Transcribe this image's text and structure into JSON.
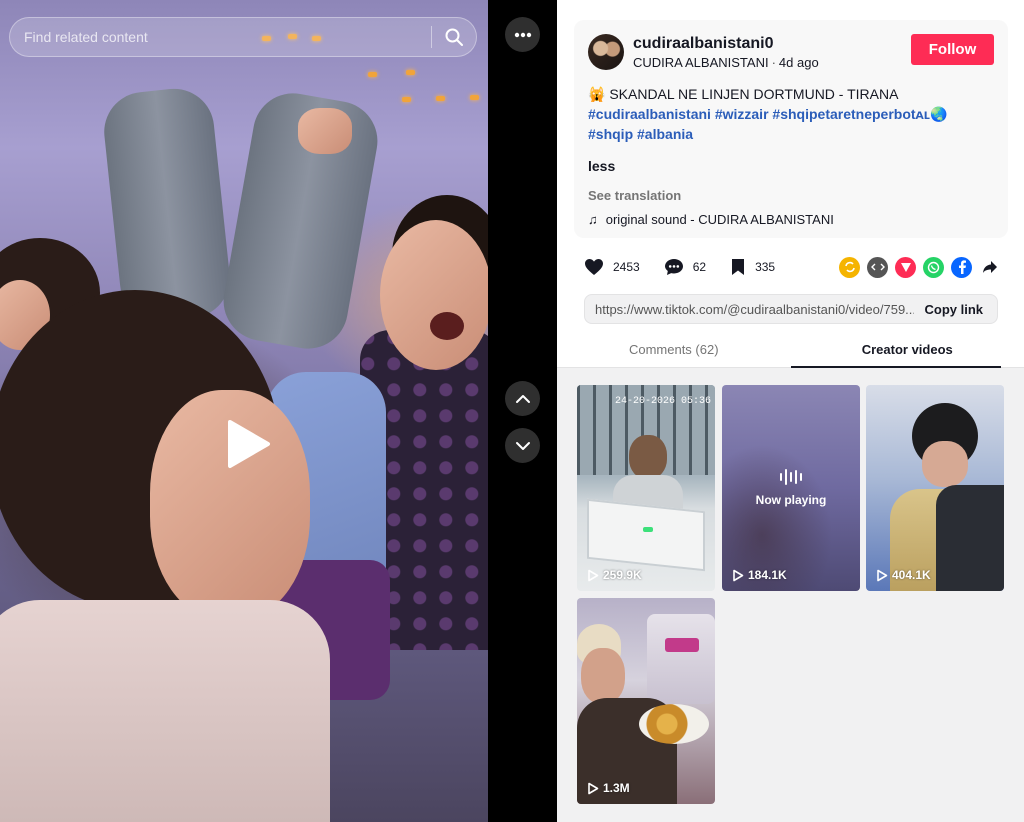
{
  "search": {
    "placeholder": "Find related content"
  },
  "author": {
    "username": "cudiraalbanistani0",
    "display_name": "CUDIRA ALBANISTANI",
    "posted": "4d ago"
  },
  "follow_label": "Follow",
  "caption": {
    "text": "🙀 SKANDAL NE LINJEN DORTMUND - TIRANA",
    "hashtags": [
      "#cudiraalbanistani",
      "#wizzair",
      "#shqipetaretneperbotᴀʟ🌏",
      "#shqip",
      "#albania"
    ]
  },
  "less_label": "less",
  "see_translation": "See translation",
  "sound": "original sound - CUDIRA ALBANISTANI",
  "stats": {
    "likes": "2453",
    "comments": "62",
    "saves": "335"
  },
  "share_icons": [
    "repost-icon",
    "embed-icon",
    "send-to-friends-icon",
    "whatsapp-icon",
    "facebook-icon",
    "share-arrow-icon"
  ],
  "link": {
    "url": "https://www.tiktok.com/@cudiraalbanistani0/video/759...",
    "copy_label": "Copy link"
  },
  "tabs": {
    "comments": "Comments (62)",
    "creator": "Creator videos"
  },
  "videos": [
    {
      "views": "259.9K",
      "overlay": "24-20-2026 05:36"
    },
    {
      "views": "184.1K",
      "now_playing": "Now playing"
    },
    {
      "views": "404.1K"
    },
    {
      "views": "1.3M"
    }
  ],
  "colors": {
    "follow": "#fe2c55",
    "hashtag": "#2b5db9",
    "tab_bg": "#f1f1f2"
  }
}
